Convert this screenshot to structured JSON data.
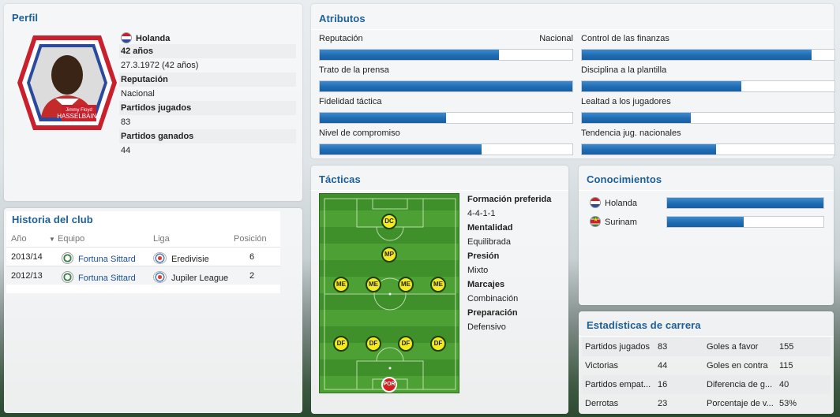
{
  "perfil": {
    "title": "Perfil",
    "nationality": "Holanda",
    "age": "42 años",
    "birth": "27.3.1972 (42 años)",
    "reputation_label": "Reputación",
    "reputation_value": "Nacional",
    "matches_label": "Partidos jugados",
    "matches_value": "83",
    "wins_label": "Partidos ganados",
    "wins_value": "44",
    "badge_first_name": "Jimmy Floyd",
    "badge_last_name": "HASSELBAINK"
  },
  "historia": {
    "title": "Historia del club",
    "columns": [
      "Año",
      "Equipo",
      "Liga",
      "Posición"
    ],
    "rows": [
      {
        "year": "2013/14",
        "team": "Fortuna Sittard",
        "league": "Eredivisie",
        "position": "6"
      },
      {
        "year": "2012/13",
        "team": "Fortuna Sittard",
        "league": "Jupiler League",
        "position": "2"
      }
    ]
  },
  "atributos": {
    "title": "Atributos",
    "items": [
      {
        "label": "Reputación",
        "value_text": "Nacional",
        "level": 0.71
      },
      {
        "label": "Control de las finanzas",
        "value_text": "",
        "level": 0.91
      },
      {
        "label": "Trato de la prensa",
        "value_text": "",
        "level": 1.0
      },
      {
        "label": "Disciplina a la plantilla",
        "value_text": "",
        "level": 0.63
      },
      {
        "label": "Fidelidad táctica",
        "value_text": "",
        "level": 0.5
      },
      {
        "label": "Lealtad a los jugadores",
        "value_text": "",
        "level": 0.43
      },
      {
        "label": "Nivel de compromiso",
        "value_text": "",
        "level": 0.64
      },
      {
        "label": "Tendencia jug. nacionales",
        "value_text": "",
        "level": 0.53
      }
    ]
  },
  "tacticas": {
    "title": "Tácticas",
    "players": {
      "dc": "DC",
      "mp": "MP",
      "me": "ME",
      "df": "DF",
      "por": "POR"
    },
    "formation_label": "Formación preferida",
    "formation_value": "4-4-1-1",
    "mentality_label": "Mentalidad",
    "mentality_value": "Equilibrada",
    "pressure_label": "Presión",
    "pressure_value": "Mixto",
    "marking_label": "Marcajes",
    "marking_value": "Combinación",
    "prep_label": "Preparación",
    "prep_value": "Defensivo"
  },
  "conocimientos": {
    "title": "Conocimientos",
    "items": [
      {
        "label": "Holanda",
        "level": 1.0
      },
      {
        "label": "Surinam",
        "level": 0.49
      }
    ]
  },
  "estadisticas": {
    "title": "Estadísticas de carrera",
    "rows": [
      {
        "l1": "Partidos jugados",
        "v1": "83",
        "l2": "Goles a favor",
        "v2": "155"
      },
      {
        "l1": "Victorias",
        "v1": "44",
        "l2": "Goles en contra",
        "v2": "115"
      },
      {
        "l1": "Partidos empat...",
        "v1": "16",
        "l2": "Diferencia de g...",
        "v2": "40"
      },
      {
        "l1": "Derrotas",
        "v1": "23",
        "l2": "Porcentaje de v...",
        "v2": "53%"
      }
    ]
  },
  "colors": {
    "accent": "#1d5f99",
    "bar": "#1f6cb3"
  }
}
